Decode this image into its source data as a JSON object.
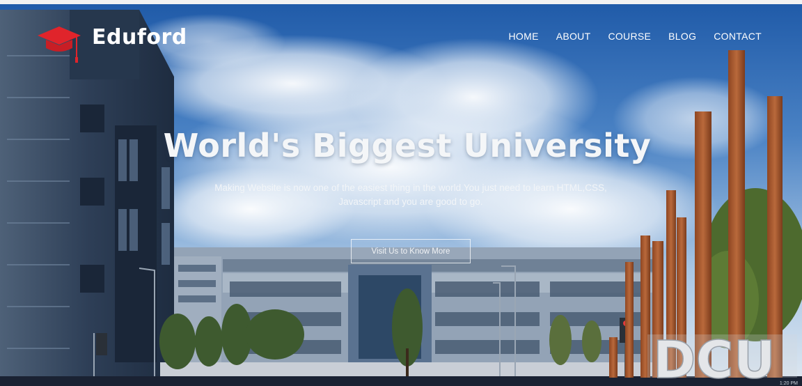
{
  "brand": {
    "name": "Eduford",
    "logo_icon": "graduation-cap-icon",
    "accent": "#e0242b"
  },
  "nav": {
    "items": [
      {
        "label": "HOME"
      },
      {
        "label": "ABOUT"
      },
      {
        "label": "COURSE"
      },
      {
        "label": "BLOG"
      },
      {
        "label": "CONTACT"
      }
    ]
  },
  "hero": {
    "title": "World's Biggest University",
    "subtitle": "Making Website is now one of the easiest thing in the world.You just need to learn HTML,CSS, Javascript and you are good to go.",
    "cta_label": "Visit Us to Know More"
  },
  "signage": {
    "campus_letters": "DCU"
  },
  "footer": {
    "timestamp": "1:20 PM"
  },
  "colors": {
    "sky": "#3c74b8",
    "building": "#3b4d68",
    "tower": "#a55a2e",
    "text": "#ffffff"
  }
}
